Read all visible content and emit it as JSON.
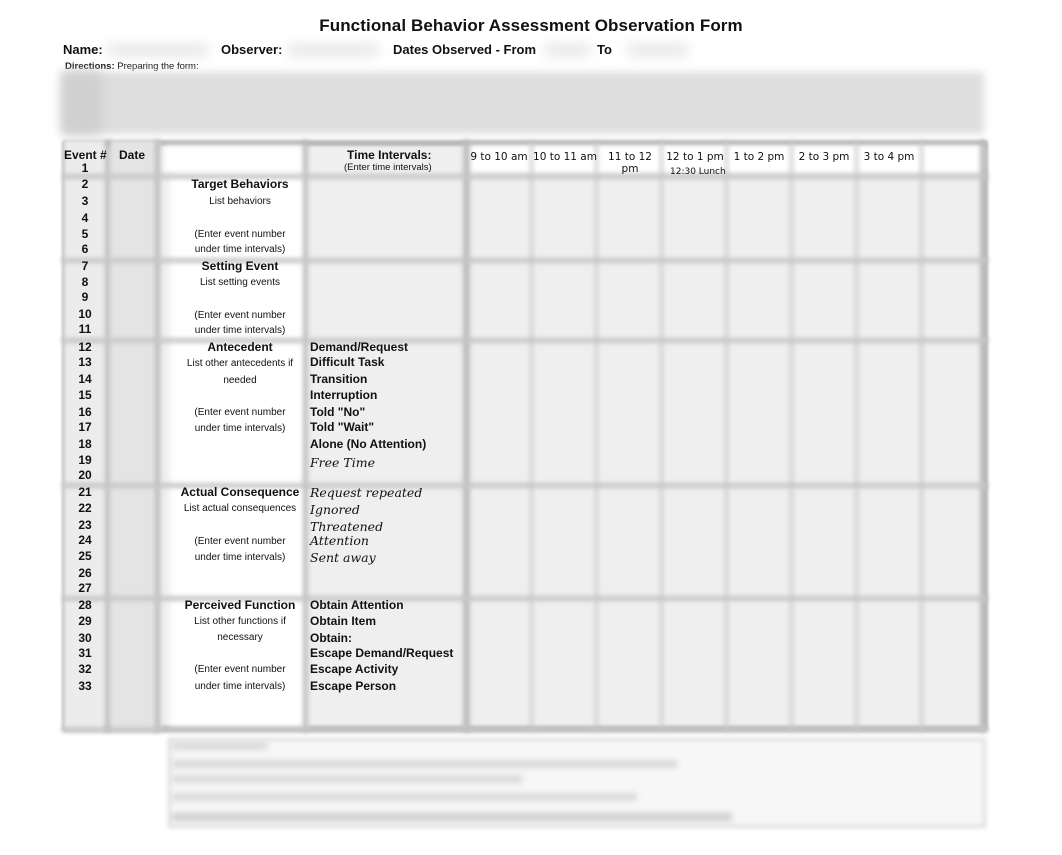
{
  "form": {
    "title": "Functional Behavior Assessment Observation Form",
    "fields": {
      "name_label": "Name:",
      "observer_label": "Observer:",
      "dates_from_label": "Dates Observed - From",
      "dates_to_label": "To"
    },
    "directions": {
      "label": "Directions:",
      "text": "Preparing the form:"
    }
  },
  "table": {
    "headers": {
      "event": "Event #",
      "date": "Date",
      "time_intervals": "Time Intervals:",
      "time_intervals_note": "(Enter time intervals)"
    },
    "time_intervals": [
      "9 to 10 am",
      "10 to 11 am",
      "11 to 12 pm",
      "12 to 1 pm",
      "1 to 2 pm",
      "2 to 3 pm",
      "3 to 4 pm"
    ],
    "lunch_note": "12:30 Lunch",
    "event_numbers": [
      "1",
      "2",
      "3",
      "4",
      "5",
      "6",
      "7",
      "8",
      "9",
      "10",
      "11",
      "12",
      "13",
      "14",
      "15",
      "16",
      "17",
      "18",
      "19",
      "20",
      "21",
      "22",
      "23",
      "24",
      "25",
      "26",
      "27",
      "28",
      "29",
      "30",
      "31",
      "32",
      "33"
    ],
    "sections": [
      {
        "title": "Target Behaviors",
        "list_note": "List behaviors",
        "list_note_2": "",
        "enter_note_1": "(Enter event number",
        "enter_note_2": "under time intervals)",
        "options": []
      },
      {
        "title": "Setting Event",
        "list_note": "List setting events",
        "list_note_2": "",
        "enter_note_1": "(Enter event number",
        "enter_note_2": "under time intervals)",
        "options": []
      },
      {
        "title": "Antecedent",
        "list_note": "List other antecedents if",
        "list_note_2": "needed",
        "enter_note_1": "(Enter event number",
        "enter_note_2": "under time intervals)",
        "options": [
          "Demand/Request",
          "Difficult Task",
          "Transition",
          "Interruption",
          "Told \"No\"",
          "Told \"Wait\"",
          "Alone (No Attention)",
          "Free Time"
        ]
      },
      {
        "title": "Actual Consequence",
        "list_note": "List actual consequences",
        "list_note_2": "",
        "enter_note_1": "(Enter event number",
        "enter_note_2": "under time intervals)",
        "options": [
          "Request repeated",
          "Ignored",
          "Threatened",
          "Attention",
          "Sent away"
        ]
      },
      {
        "title": "Perceived Function",
        "list_note": "List other functions if",
        "list_note_2": "necessary",
        "enter_note_1": "(Enter event number",
        "enter_note_2": "under time intervals)",
        "options": [
          "Obtain Attention",
          "Obtain Item",
          "Obtain:",
          "Escape Demand/Request",
          "Escape Activity",
          "Escape Person"
        ]
      }
    ]
  }
}
